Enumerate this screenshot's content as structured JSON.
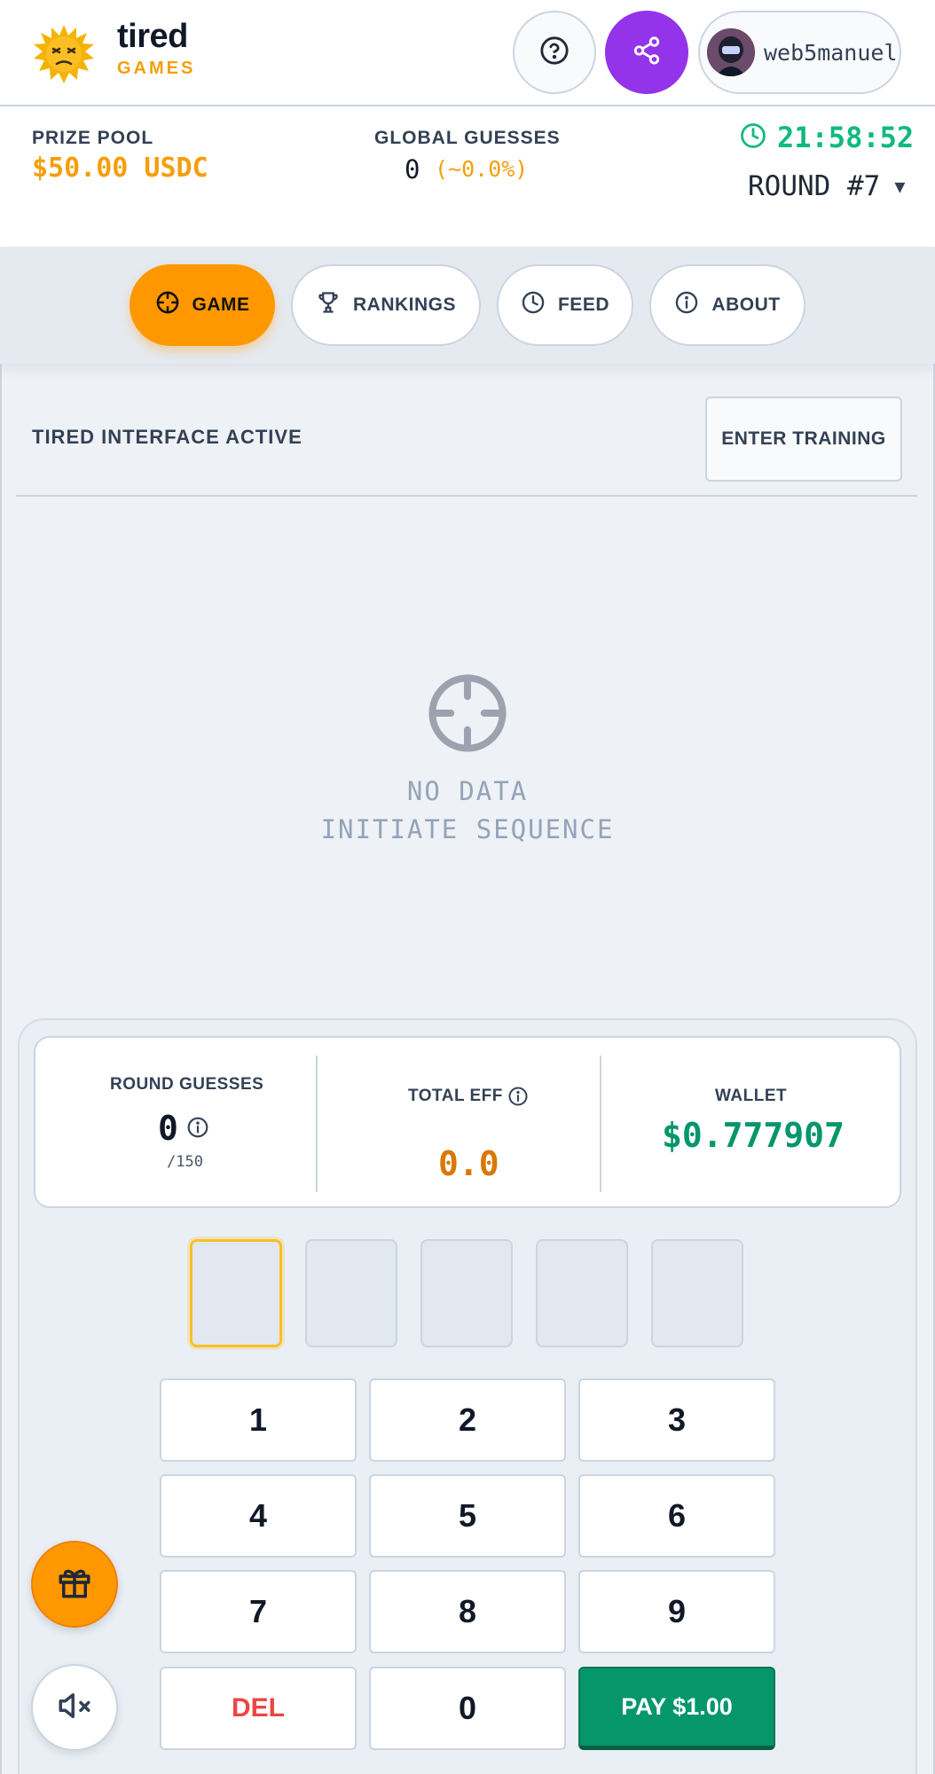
{
  "brand": {
    "name": "tired",
    "sub": "GAMES",
    "accent": "#f59e0b"
  },
  "header": {
    "help_icon": "question-circle-icon",
    "share_icon": "share-icon",
    "username": "web5manuel"
  },
  "stats": {
    "prize_label": "PRIZE POOL",
    "prize_value": "$50.00 USDC",
    "global_label": "GLOBAL GUESSES",
    "global_value": "0",
    "global_pct": "(~0.0%)",
    "timer": "21:58:52",
    "round": "ROUND #7",
    "round_caret": "▼"
  },
  "nav": {
    "tabs": [
      {
        "label": "GAME",
        "icon": "crosshair-icon",
        "active": true
      },
      {
        "label": "RANKINGS",
        "icon": "trophy-icon",
        "active": false
      },
      {
        "label": "FEED",
        "icon": "clock-icon",
        "active": false
      },
      {
        "label": "ABOUT",
        "icon": "info-icon",
        "active": false
      }
    ]
  },
  "main": {
    "status": "TIRED INTERFACE ACTIVE",
    "training_button": "ENTER TRAINING",
    "empty_line1": "NO DATA",
    "empty_line2": "INITIATE SEQUENCE"
  },
  "summary": {
    "round_guesses_label": "ROUND GUESSES",
    "round_guesses_value": "0",
    "round_guesses_max": "/150",
    "total_eff_label": "TOTAL EFF",
    "total_eff_value": "0.0",
    "wallet_label": "WALLET",
    "wallet_value": "$0.777907"
  },
  "slots": [
    "",
    "",
    "",
    "",
    ""
  ],
  "keypad": {
    "keys": [
      "1",
      "2",
      "3",
      "4",
      "5",
      "6",
      "7",
      "8",
      "9"
    ],
    "del": "DEL",
    "zero": "0",
    "pay": "PAY $1.00"
  },
  "colors": {
    "orange": "#ff9800",
    "purple": "#9333ea",
    "green": "#059669",
    "timer": "#10b981",
    "danger": "#ef4444"
  }
}
